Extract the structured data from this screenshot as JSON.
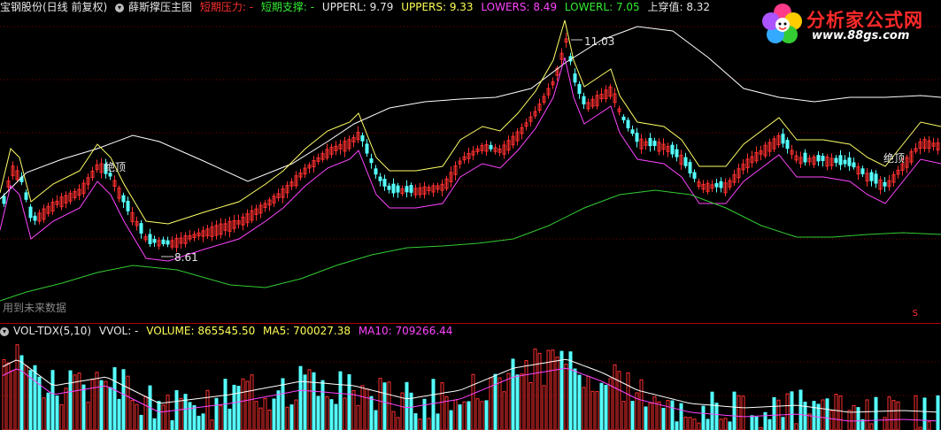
{
  "main_header": {
    "stock": "宝钢股份(日线 前复权)",
    "indicator": "薛斯撑压主图",
    "short_pressure": "短期压力: -",
    "short_support": "短期支撑: -",
    "upperl": "UPPERL: 9.79",
    "uppers": "UPPERS: 9.33",
    "lowers": "LOWERS: 8.49",
    "lowerl": "LOWERL: 7.05",
    "cross": "上穿值: 8.32"
  },
  "annotations": {
    "high_price": "11.03",
    "low_price": "8.61",
    "top_left": "绝顶",
    "top_right": "绝顶",
    "future_data": "用到未来数据",
    "side_marker": "S"
  },
  "volume_header": {
    "name": "VOL-TDX(5,10)",
    "vvol": "VVOL: -",
    "volume": "VOLUME: 865545.50",
    "ma5": "MA5: 700027.38",
    "ma10": "MA10: 709266.44"
  },
  "logo": {
    "title": "分析家公式网",
    "url": "www.88gs.com"
  },
  "colors": {
    "up": "#ff3030",
    "down": "#55ffff",
    "upper_band": "#ffffff",
    "short_pressure": "#ffff66",
    "short_support": "#ff44ff",
    "long_support": "#33cc33",
    "separator": "#b00000"
  }
}
